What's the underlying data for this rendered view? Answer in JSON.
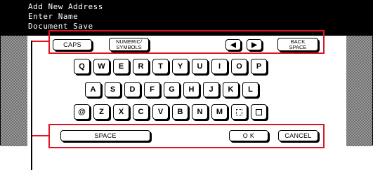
{
  "header": {
    "line1": "Add New Address",
    "line2": "Enter Name",
    "line3": "Document Save"
  },
  "function_row": {
    "caps": "CAPS",
    "numeric_symbols_line1": "NUMERIC/",
    "numeric_symbols_line2": "SYMBOLS",
    "back_space_line1": "BACK",
    "back_space_line2": "SPACE",
    "left_arrow": "◀",
    "right_arrow": "▶"
  },
  "keyboard": {
    "row1": [
      "Q",
      "W",
      "E",
      "R",
      "T",
      "Y",
      "U",
      "I",
      "O",
      "P"
    ],
    "row2": [
      "A",
      "S",
      "D",
      "F",
      "G",
      "H",
      "J",
      "K",
      "L"
    ],
    "row3": [
      "@",
      "Z",
      "X",
      "C",
      "V",
      "B",
      "N",
      "M"
    ]
  },
  "bottom_row": {
    "space": "SPACE",
    "ok": "O K",
    "cancel": "CANCEL"
  },
  "colors": {
    "callout": "#e0141e",
    "lcd_header": "#000000"
  }
}
